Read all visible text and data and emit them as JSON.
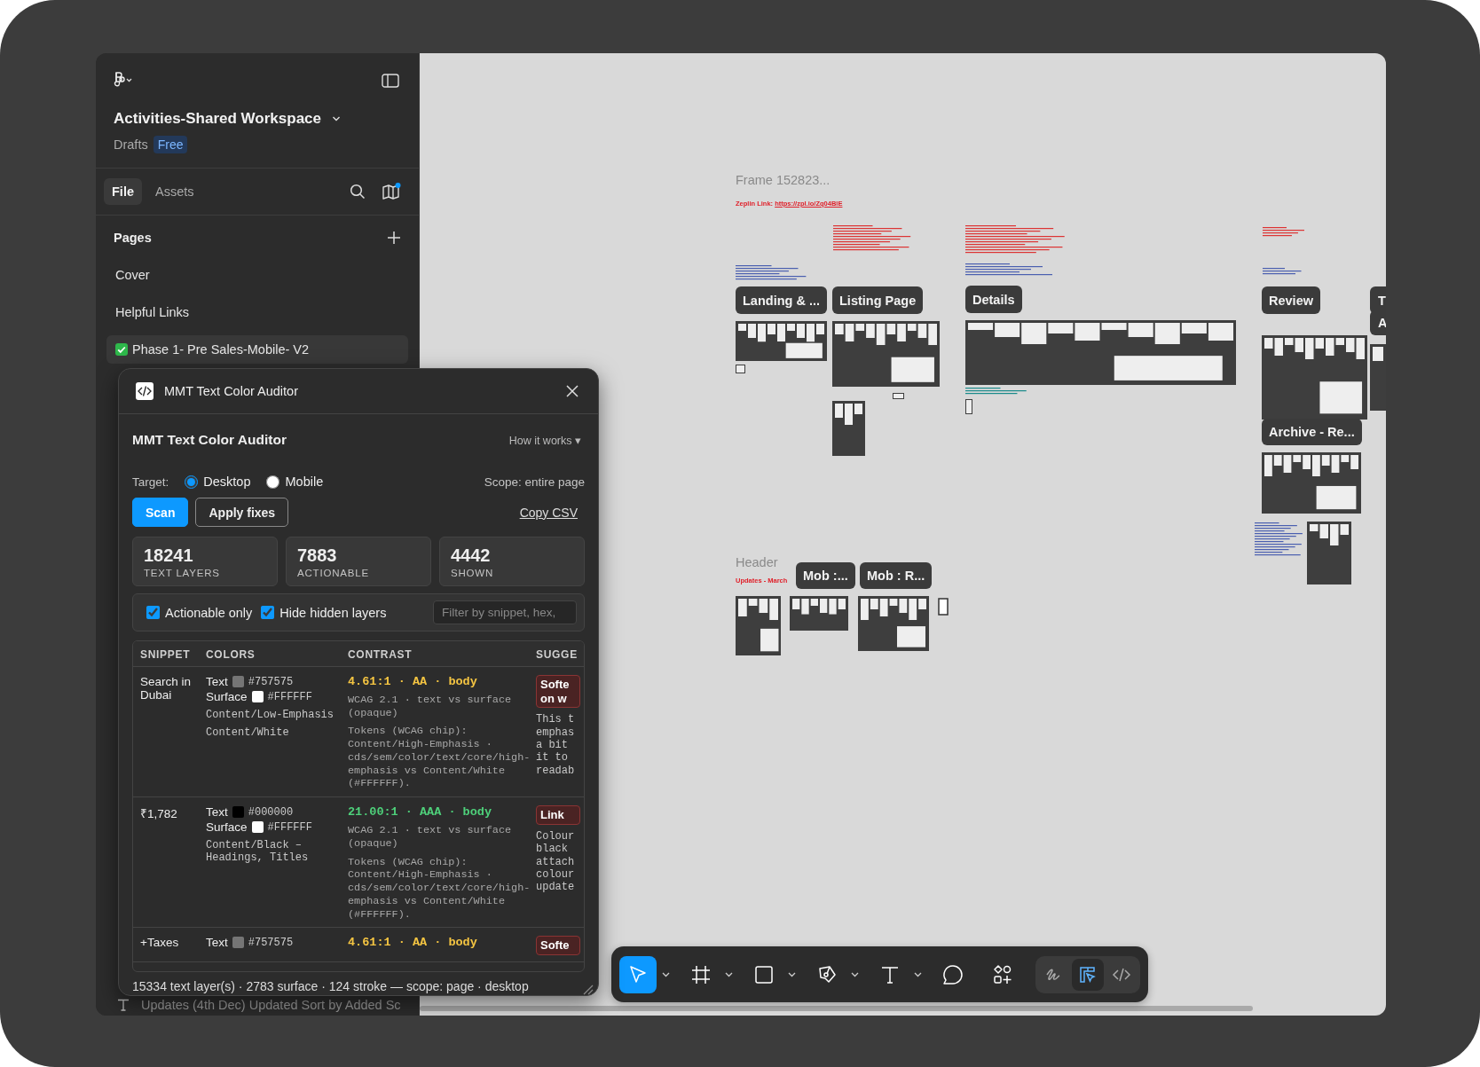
{
  "sidebar": {
    "workspace": "Activities-Shared Workspace",
    "location": "Drafts",
    "plan_badge": "Free",
    "tabs": [
      {
        "label": "File",
        "selected": true
      },
      {
        "label": "Assets",
        "selected": false
      }
    ],
    "library_notification": true,
    "pages_heading": "Pages",
    "pages": [
      {
        "label": "Cover",
        "selected": false,
        "done": false
      },
      {
        "label": "Helpful Links",
        "selected": false,
        "done": false
      },
      {
        "label": "Phase 1- Pre Sales-Mobile- V2",
        "selected": true,
        "done": true
      }
    ],
    "layer_row": "Updates (4th Dec) Updated Sort by Added Sc"
  },
  "plugin": {
    "window_title": "MMT Text Color Auditor",
    "title": "MMT Text Color Auditor",
    "help": "How it works ▾",
    "target_label": "Target:",
    "targets": [
      {
        "label": "Desktop",
        "selected": true
      },
      {
        "label": "Mobile",
        "selected": false
      }
    ],
    "scope": "Scope: entire page",
    "buttons": [
      {
        "label": "Scan",
        "kind": "primary"
      },
      {
        "label": "Apply fixes",
        "kind": "secondary"
      }
    ],
    "copy_link": "Copy CSV",
    "stats": [
      {
        "value": "18241",
        "label": "TEXT LAYERS"
      },
      {
        "value": "7883",
        "label": "ACTIONABLE"
      },
      {
        "value": "4442",
        "label": "SHOWN"
      }
    ],
    "filters": [
      {
        "label": "Actionable only",
        "checked": true
      },
      {
        "label": "Hide hidden layers",
        "checked": true
      }
    ],
    "search": {
      "placeholder": "Filter by snippet, hex,"
    },
    "table": {
      "columns": [
        "SNIPPET",
        "COLORS",
        "CONTRAST",
        "SUGGE"
      ],
      "rows": [
        {
          "snippet": "Search in Dubai",
          "colors": [
            {
              "label": "Text",
              "hex": "#757575"
            },
            {
              "label": "Surface",
              "hex": "#FFFFFF"
            }
          ],
          "tokens": [
            "Content/Low-Emphasis",
            "Content/White"
          ],
          "contrast": {
            "rating": "4.61:1 · AA · body",
            "color": "#f5c542",
            "method": "WCAG 2.1 · text vs surface (opaque)",
            "tokens": "Tokens (WCAG chip): Content/High-Emphasis · cds/sem/color/text/core/high-emphasis vs Content/White (#FFFFFF)."
          },
          "suggestion": {
            "badge": "Softe on w",
            "note": "This t emphas a bit it to readab"
          }
        },
        {
          "snippet": "₹1,782",
          "colors": [
            {
              "label": "Text",
              "hex": "#000000"
            },
            {
              "label": "Surface",
              "hex": "#FFFFFF"
            }
          ],
          "tokens": [
            "Content/Black – Headings, Titles"
          ],
          "contrast": {
            "rating": "21.00:1 · AAA · body",
            "color": "#4ed07a",
            "method": "WCAG 2.1 · text vs surface (opaque)",
            "tokens": "Tokens (WCAG chip): Content/High-Emphasis · cds/sem/color/text/core/high-emphasis vs Content/White (#FFFFFF)."
          },
          "suggestion": {
            "badge": "Link",
            "note": "Colour black attach colour update"
          }
        },
        {
          "snippet": "+Taxes",
          "colors": [
            {
              "label": "Text",
              "hex": "#757575"
            }
          ],
          "tokens": [],
          "contrast": {
            "rating": "4.61:1 · AA · body",
            "color": "#f5c542"
          },
          "suggestion": {
            "badge": "Softe"
          }
        }
      ]
    },
    "footer": "15334 text layer(s) · 2783 surface · 124 stroke — scope: page · desktop"
  },
  "canvas": {
    "frame_title": "Frame 152823...",
    "link_label": "Zeplin Link:",
    "link_url": "https://zpl.io/Zq04BlE",
    "header_title": "Header",
    "header_note": "Updates - March",
    "labels": [
      "Landing & ...",
      "Listing Page",
      "Details",
      "Review",
      "Archive - Re...",
      "Mob :...",
      "Mob : R...",
      "T",
      "A"
    ]
  },
  "toolbar": {
    "tools": [
      {
        "kind": "move",
        "selected": true,
        "has_menu": true
      },
      {
        "kind": "frame",
        "selected": false,
        "has_menu": true
      },
      {
        "kind": "rectangle",
        "selected": false,
        "has_menu": true
      },
      {
        "kind": "pen",
        "selected": false,
        "has_menu": true
      },
      {
        "kind": "text",
        "selected": false,
        "has_menu": true
      },
      {
        "kind": "comment",
        "selected": false
      },
      {
        "kind": "actions",
        "selected": false
      }
    ],
    "modes": [
      {
        "kind": "draw",
        "selected": false
      },
      {
        "kind": "design",
        "selected": true
      },
      {
        "kind": "dev",
        "selected": false
      }
    ]
  }
}
